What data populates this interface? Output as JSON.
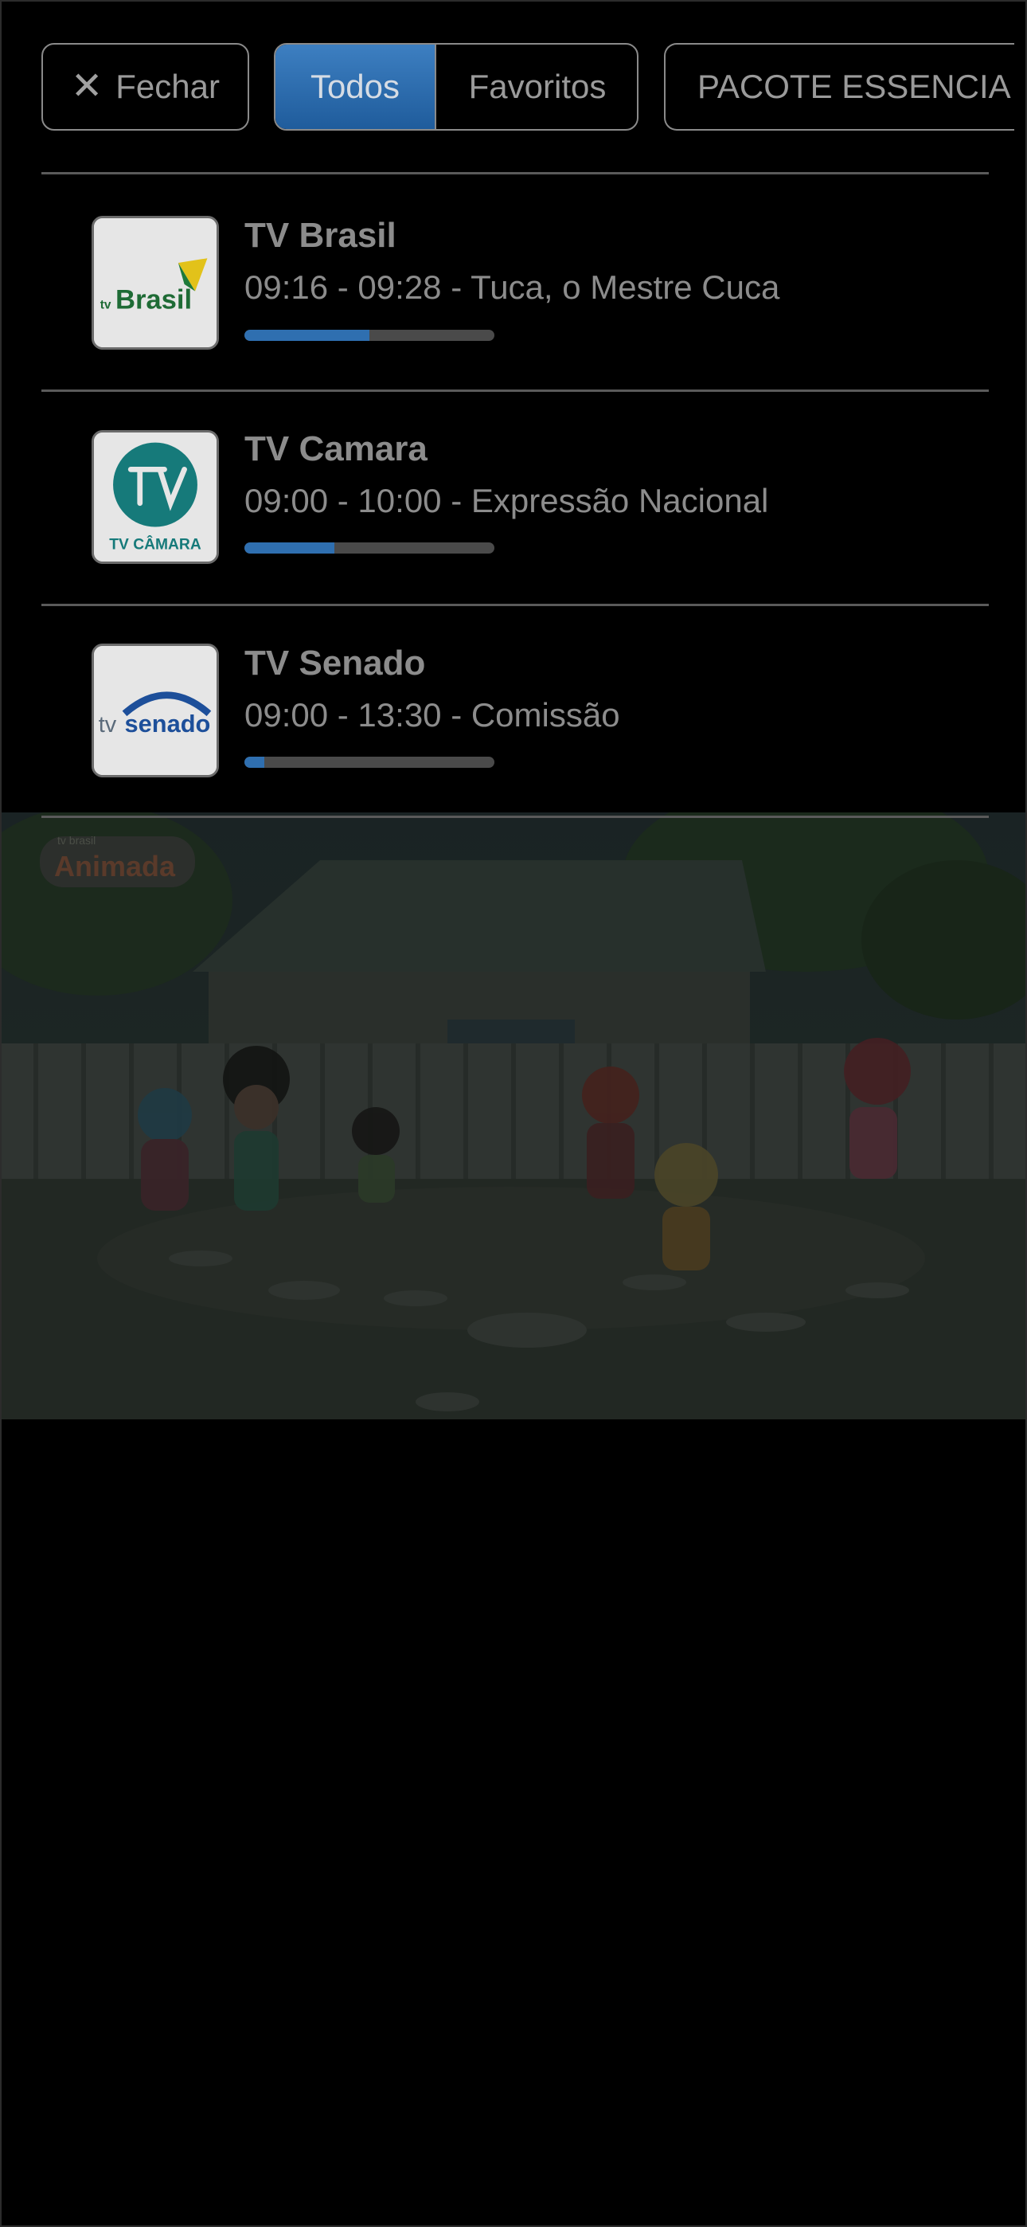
{
  "toolbar": {
    "close_label": "Fechar",
    "filter_all_label": "Todos",
    "filter_favorites_label": "Favoritos",
    "package_label": "PACOTE ESSENCIA"
  },
  "channels": [
    {
      "name": "TV Brasil",
      "program": "09:16 - 09:28 - Tuca, o Mestre Cuca",
      "progress": 0.5,
      "logo_text_small": "tv",
      "logo_text": "Brasil"
    },
    {
      "name": "TV Camara",
      "program": "09:00 - 10:00 - Expressão Nacional",
      "progress": 0.36,
      "logo_text": "TV CÂMARA"
    },
    {
      "name": "TV Senado",
      "program": "09:00 - 13:30 - Comissão",
      "progress": 0.08,
      "logo_text_small": "tv",
      "logo_text": "senado"
    }
  ],
  "video": {
    "watermark_small": "tv brasil",
    "watermark": "Animada"
  },
  "colors": {
    "accent": "#2f6fb0",
    "active_segment": "#3d7fc1",
    "text": "#8c8c8c",
    "background": "#000000"
  }
}
